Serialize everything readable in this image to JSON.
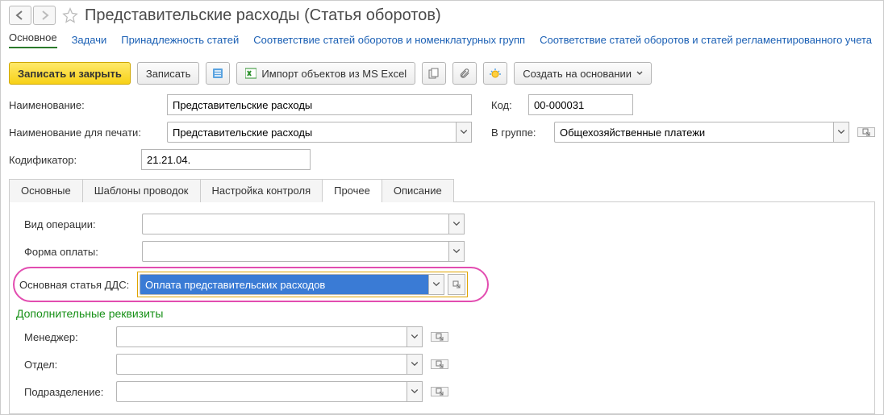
{
  "header": {
    "title": "Представительские расходы (Статья оборотов)",
    "nav_tabs": {
      "main": "Основное",
      "tasks": "Задачи",
      "membership": "Принадлежность статей",
      "corr_nom": "Соответствие статей оборотов и номенклатурных групп",
      "corr_reg": "Соответствие статей оборотов и статей регламентированного учета"
    }
  },
  "toolbar": {
    "save_close": "Записать и закрыть",
    "save": "Записать",
    "import_excel": "Импорт объектов из MS Excel",
    "create_based": "Создать на основании"
  },
  "fields": {
    "name_label": "Наименование:",
    "name_value": "Представительские расходы",
    "code_label": "Код:",
    "code_value": "00-000031",
    "print_name_label": "Наименование для печати:",
    "print_name_value": "Представительские расходы",
    "group_label": "В группе:",
    "group_value": "Общехозяйственные платежи",
    "codifier_label": "Кодификатор:",
    "codifier_value": "21.21.04."
  },
  "subtabs": {
    "main": "Основные",
    "templates": "Шаблоны проводок",
    "control": "Настройка контроля",
    "other": "Прочее",
    "desc": "Описание"
  },
  "other_tab": {
    "op_type_label": "Вид операции:",
    "op_type_value": "",
    "pay_form_label": "Форма оплаты:",
    "pay_form_value": "",
    "dds_label": "Основная статья ДДС:",
    "dds_value": "Оплата представительских расходов",
    "extra_heading": "Дополнительные реквизиты",
    "manager_label": "Менеджер:",
    "manager_value": "",
    "dept_label": "Отдел:",
    "dept_value": "",
    "subdiv_label": "Подразделение:",
    "subdiv_value": ""
  }
}
